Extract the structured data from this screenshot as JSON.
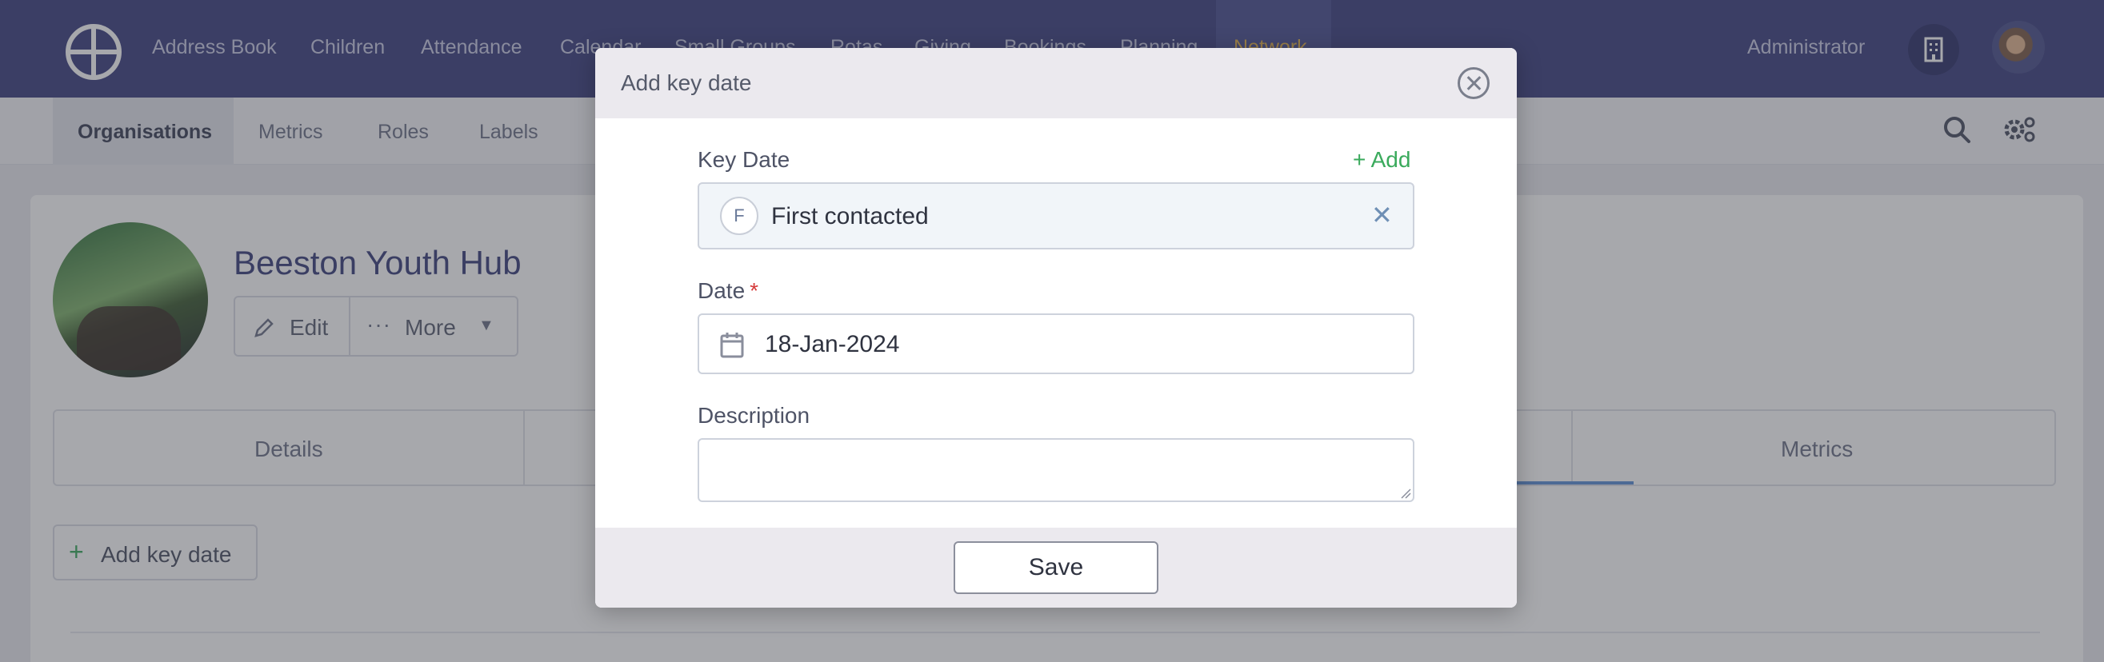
{
  "topnav": {
    "logo": "logo-icon",
    "items": [
      "Address Book",
      "Children",
      "Attendance",
      "Calendar",
      "Small Groups",
      "Rotas",
      "Giving",
      "Bookings",
      "Planning",
      "Network"
    ],
    "user_label": "Administrator",
    "building_icon": "building-icon",
    "avatar": "user-avatar"
  },
  "subnav": {
    "items": [
      "Organisations",
      "Metrics",
      "Roles",
      "Labels"
    ],
    "active": "Organisations",
    "search_icon": "search-icon",
    "settings_icon": "cog-icon"
  },
  "organisation": {
    "name": "Beeston Youth Hub",
    "edit_label": "Edit",
    "more_label": "More",
    "tabs": [
      "Details",
      "Metrics"
    ],
    "add_key_date_label": "Add key date"
  },
  "modal": {
    "title": "Add key date",
    "key_date_label": "Key Date",
    "add_link": "+ Add",
    "key_date_badge": "F",
    "key_date_value": "First contacted",
    "date_label": "Date",
    "date_required_marker": "*",
    "date_value": "18-Jan-2024",
    "description_label": "Description",
    "description_value": "",
    "save_label": "Save"
  },
  "colors": {
    "nav_bg": "#3b3f7e",
    "accent_green": "#3aaa5c",
    "required_red": "#d53b3b",
    "tab_active": "#5b8ed6"
  }
}
